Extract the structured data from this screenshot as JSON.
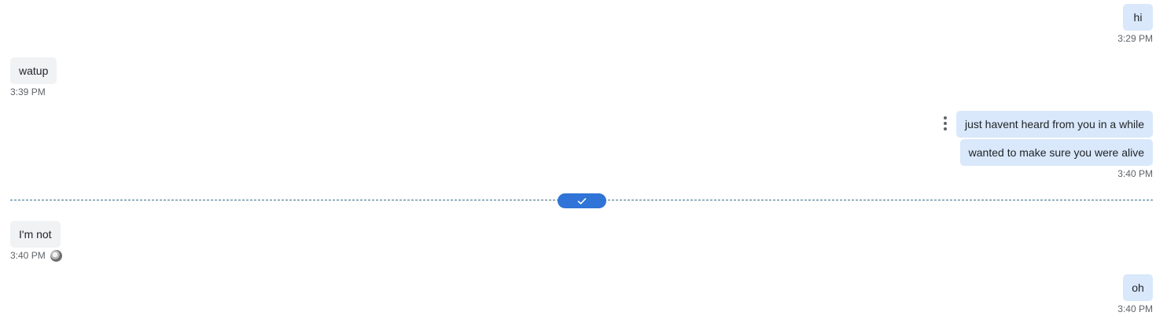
{
  "messages": [
    {
      "direction": "out",
      "text": "hi",
      "time": "3:29 PM"
    },
    {
      "direction": "in",
      "text": "watup",
      "time": "3:39 PM"
    },
    {
      "direction": "out",
      "texts": [
        "just havent heard from you in a while",
        "wanted to make sure you were alive"
      ],
      "time": "3:40 PM"
    },
    {
      "direction": "in",
      "text": "I'm not",
      "time": "3:40 PM"
    },
    {
      "direction": "out",
      "text": "oh",
      "time": "3:40 PM"
    }
  ],
  "icons": {
    "message_options": "kebab-vertical-icon",
    "read_marker": "checkmark-icon",
    "read_receipt_avatar": "avatar-icon"
  },
  "colors": {
    "incoming_bubble": "#f1f2f4",
    "outgoing_bubble": "#d9e8fa",
    "read_marker": "#2f74d6",
    "divider": "#3b6e8a",
    "timestamp": "#5f6368"
  }
}
